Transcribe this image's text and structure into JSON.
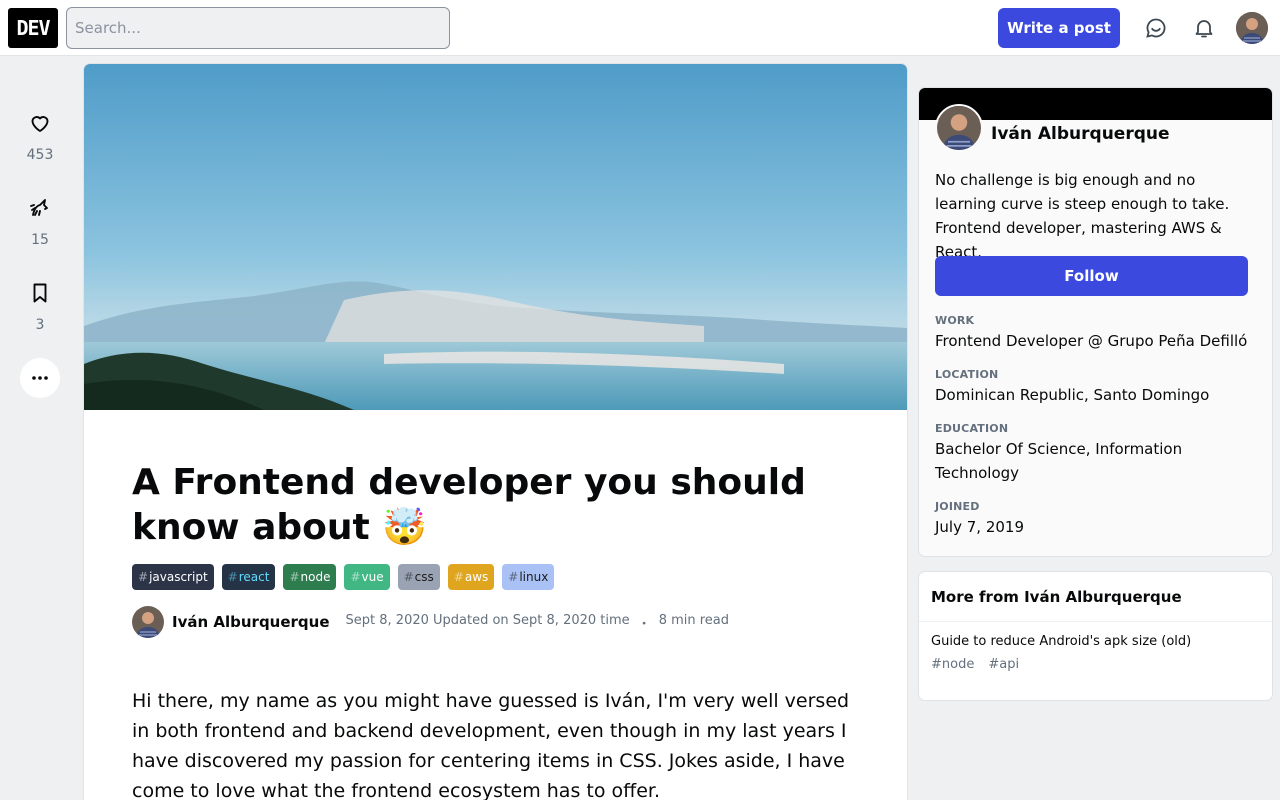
{
  "header": {
    "logo": "DEV",
    "search_placeholder": "Search...",
    "write_post_label": "Write a post"
  },
  "reactions": [
    {
      "icon": "heart-icon",
      "count": "453"
    },
    {
      "icon": "unicorn-icon",
      "count": "15"
    },
    {
      "icon": "bookmark-icon",
      "count": "3"
    },
    {
      "icon": "more-icon",
      "count": ""
    }
  ],
  "article": {
    "title": "A Frontend developer you should know about 🤯",
    "tags": [
      {
        "label": "javascript",
        "bg": "#2c3548",
        "fg": "#ffffff"
      },
      {
        "label": "react",
        "bg": "#243346",
        "fg": "#61dafb"
      },
      {
        "label": "node",
        "bg": "#2e7d4f",
        "fg": "#ffffff"
      },
      {
        "label": "vue",
        "bg": "#41b883",
        "fg": "#ffffff"
      },
      {
        "label": "css",
        "bg": "#9aa3b4",
        "fg": "#1b1b1b"
      },
      {
        "label": "aws",
        "bg": "#e0a51e",
        "fg": "#ffffff"
      },
      {
        "label": "linux",
        "bg": "#a9c1f5",
        "fg": "#1b1b1b"
      }
    ],
    "author": "Iván Alburquerque",
    "date_text": "Sept 8, 2020 Updated on Sept 8, 2020 time",
    "separator": "・",
    "read_time": "8 min read",
    "body": "Hi there, my name as you might have guessed is Iván, I'm very well versed in both frontend and backend development, even though in my last years I have discovered my passion for centering items in CSS. Jokes aside, I have come to love what the frontend ecosystem has to offer."
  },
  "profile": {
    "name": "Iván Alburquerque",
    "bio": "No challenge is big enough and no learning curve is steep enough to take. Frontend developer, mastering AWS & React.",
    "follow_label": "Follow",
    "details": [
      {
        "key": "WORK",
        "value": "Frontend Developer @ Grupo Peña Defilló"
      },
      {
        "key": "LOCATION",
        "value": "Dominican Republic, Santo Domingo"
      },
      {
        "key": "EDUCATION",
        "value": "Bachelor Of Science, Information Technology"
      },
      {
        "key": "JOINED",
        "value": "July 7, 2019"
      }
    ]
  },
  "more_from": {
    "heading": "More from Iván Alburquerque",
    "items": [
      {
        "title": "Guide to reduce Android's apk size (old)",
        "tags": [
          "#node",
          "#api"
        ]
      }
    ]
  },
  "colors": {
    "accent": "#3b49df",
    "page_bg": "#eef0f1"
  }
}
